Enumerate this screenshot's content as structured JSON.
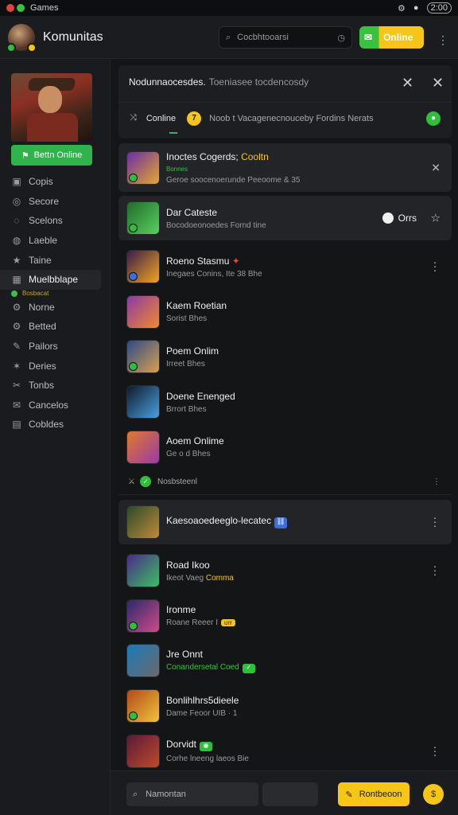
{
  "statusbar": {
    "title": "Games",
    "clock": "2:00"
  },
  "header": {
    "app_title": "Komunitas",
    "search_placeholder": "Cocbhtooarsi",
    "online_button": "Online"
  },
  "sidebar": {
    "play_button": "Bettn Online",
    "items": [
      {
        "label": "Copis",
        "icon": "dashboard-icon"
      },
      {
        "label": "Secore",
        "icon": "user-icon"
      },
      {
        "label": "Scelons",
        "icon": "chat-icon"
      },
      {
        "label": "Laeble",
        "icon": "globe-icon"
      },
      {
        "label": "Taine",
        "icon": "trophy-icon"
      },
      {
        "label": "Muelbblape",
        "icon": "grid-icon",
        "active": true
      },
      {
        "label": "Norne",
        "icon": "gear-icon"
      },
      {
        "label": "Betted",
        "icon": "settings-icon"
      },
      {
        "label": "Pailors",
        "icon": "pin-icon"
      },
      {
        "label": "Deries",
        "icon": "star-icon"
      },
      {
        "label": "Tonbs",
        "icon": "tools-icon"
      },
      {
        "label": "Cancelos",
        "icon": "mail-icon"
      },
      {
        "label": "Cobldes",
        "icon": "inbox-icon"
      }
    ],
    "sub_label": "Bosbacat"
  },
  "panel": {
    "title": "Nodunnaocesdes.",
    "title_sub": "Toeniasee tocdencosdy",
    "tab_online": "Conline",
    "tab_count": "7",
    "tab_desc": "Noob t Vacagenecnouceby Fordins Nerats"
  },
  "friends": [
    {
      "name": "Inoctes Cogerds;",
      "name_accent": "Cooltn",
      "status": "Bonnes",
      "meta": "Geroe soocenoerunde Peeoome & 35",
      "type": "card",
      "colors": [
        "#6a2ca8",
        "#e4a82a"
      ]
    },
    {
      "name": "Dar Cateste",
      "meta": "Bocodoeonoedes Fornd tine",
      "type": "card2",
      "follow": "Orrs",
      "colors": [
        "#1f6b2a",
        "#58d15e"
      ]
    },
    {
      "name": "Roeno Stasmu",
      "meta": "Inegaes Conins, Ite 38 Bhe",
      "type": "row",
      "colors": [
        "#3a1c4a",
        "#f2a51f"
      ]
    },
    {
      "name": "Kaem Roetian",
      "meta": "Sorist Bhes",
      "type": "row",
      "colors": [
        "#8a3aa8",
        "#f28a2a"
      ]
    },
    {
      "name": "Poem Onlim",
      "meta": "Irreet Bhes",
      "type": "row",
      "colors": [
        "#2a4a8a",
        "#d8a04a"
      ]
    },
    {
      "name": "Doene Enenged",
      "meta": "Brrort Bhes",
      "type": "row",
      "colors": [
        "#0f1a2a",
        "#4aa0e0"
      ]
    },
    {
      "name": "Aoem Onlime",
      "meta": "Ge o d Bhes",
      "type": "row",
      "colors": [
        "#e07a2a",
        "#9a3aa8"
      ]
    },
    {
      "name": "Kaesoaoedeeglo-lecatec",
      "meta": "",
      "type": "rowcard",
      "tag": "blue",
      "colors": [
        "#2a4a2a",
        "#c08a3a"
      ]
    },
    {
      "name": "Road Ikoo",
      "meta": "Ikeot Vaeg",
      "meta_accent": "Comma",
      "type": "row",
      "colors": [
        "#4a2a8a",
        "#3ac05e"
      ]
    },
    {
      "name": "Ironme",
      "meta": "Roane Reeer I",
      "tag": "yellow",
      "tag_text": "urr",
      "type": "row",
      "colors": [
        "#2a2a6a",
        "#d04a8a"
      ]
    },
    {
      "name": "Jre Onnt",
      "meta_green": "Conandersetal Coed",
      "type": "row",
      "colors": [
        "#1a7aba",
        "#6a6a6a"
      ]
    },
    {
      "name": "Bonlihlhrs5dieele",
      "meta": "Dame Feoor UIB · 1",
      "type": "row",
      "colors": [
        "#b04a1a",
        "#f2c23a"
      ]
    },
    {
      "name": "Dorvidt",
      "meta": "Corhe lneeng laeos Bie",
      "type": "row",
      "tag": "green",
      "colors": [
        "#5a1a3a",
        "#c04a2a"
      ]
    }
  ],
  "divider": {
    "label": "Nosbsteenl"
  },
  "bottombar": {
    "input_placeholder": "Namontan",
    "recommend_button": "Rontbeoon"
  },
  "colors": {
    "accent": "#f5c518",
    "green": "#2fbf3a",
    "bg": "#141517"
  }
}
